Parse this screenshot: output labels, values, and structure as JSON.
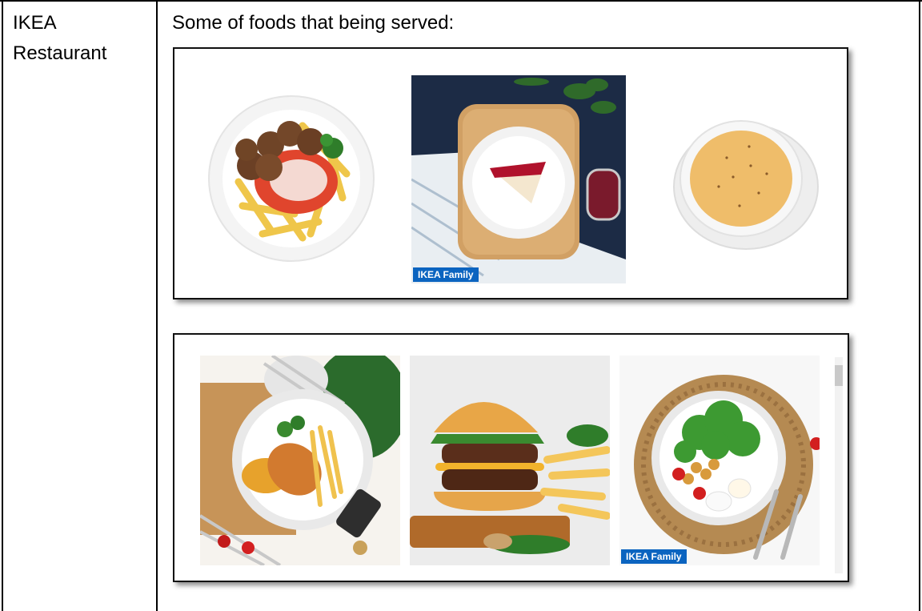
{
  "table": {
    "left_cell": {
      "line1": "IKEA",
      "line2": "Restaurant"
    },
    "right_cell": {
      "heading": "Some of foods that being served:"
    }
  },
  "panels": [
    {
      "photos": [
        {
          "icon": "meatballs-pasta-icon"
        },
        {
          "icon": "cheesecake-icon",
          "badge": "IKEA Family"
        },
        {
          "icon": "soup-bowl-icon"
        }
      ]
    },
    {
      "photos": [
        {
          "icon": "fried-fish-fries-icon"
        },
        {
          "icon": "burger-fries-icon"
        },
        {
          "icon": "salad-plate-icon",
          "badge": "IKEA Family"
        }
      ]
    }
  ],
  "colors": {
    "badge": "#0b64c0",
    "border": "#000000"
  }
}
